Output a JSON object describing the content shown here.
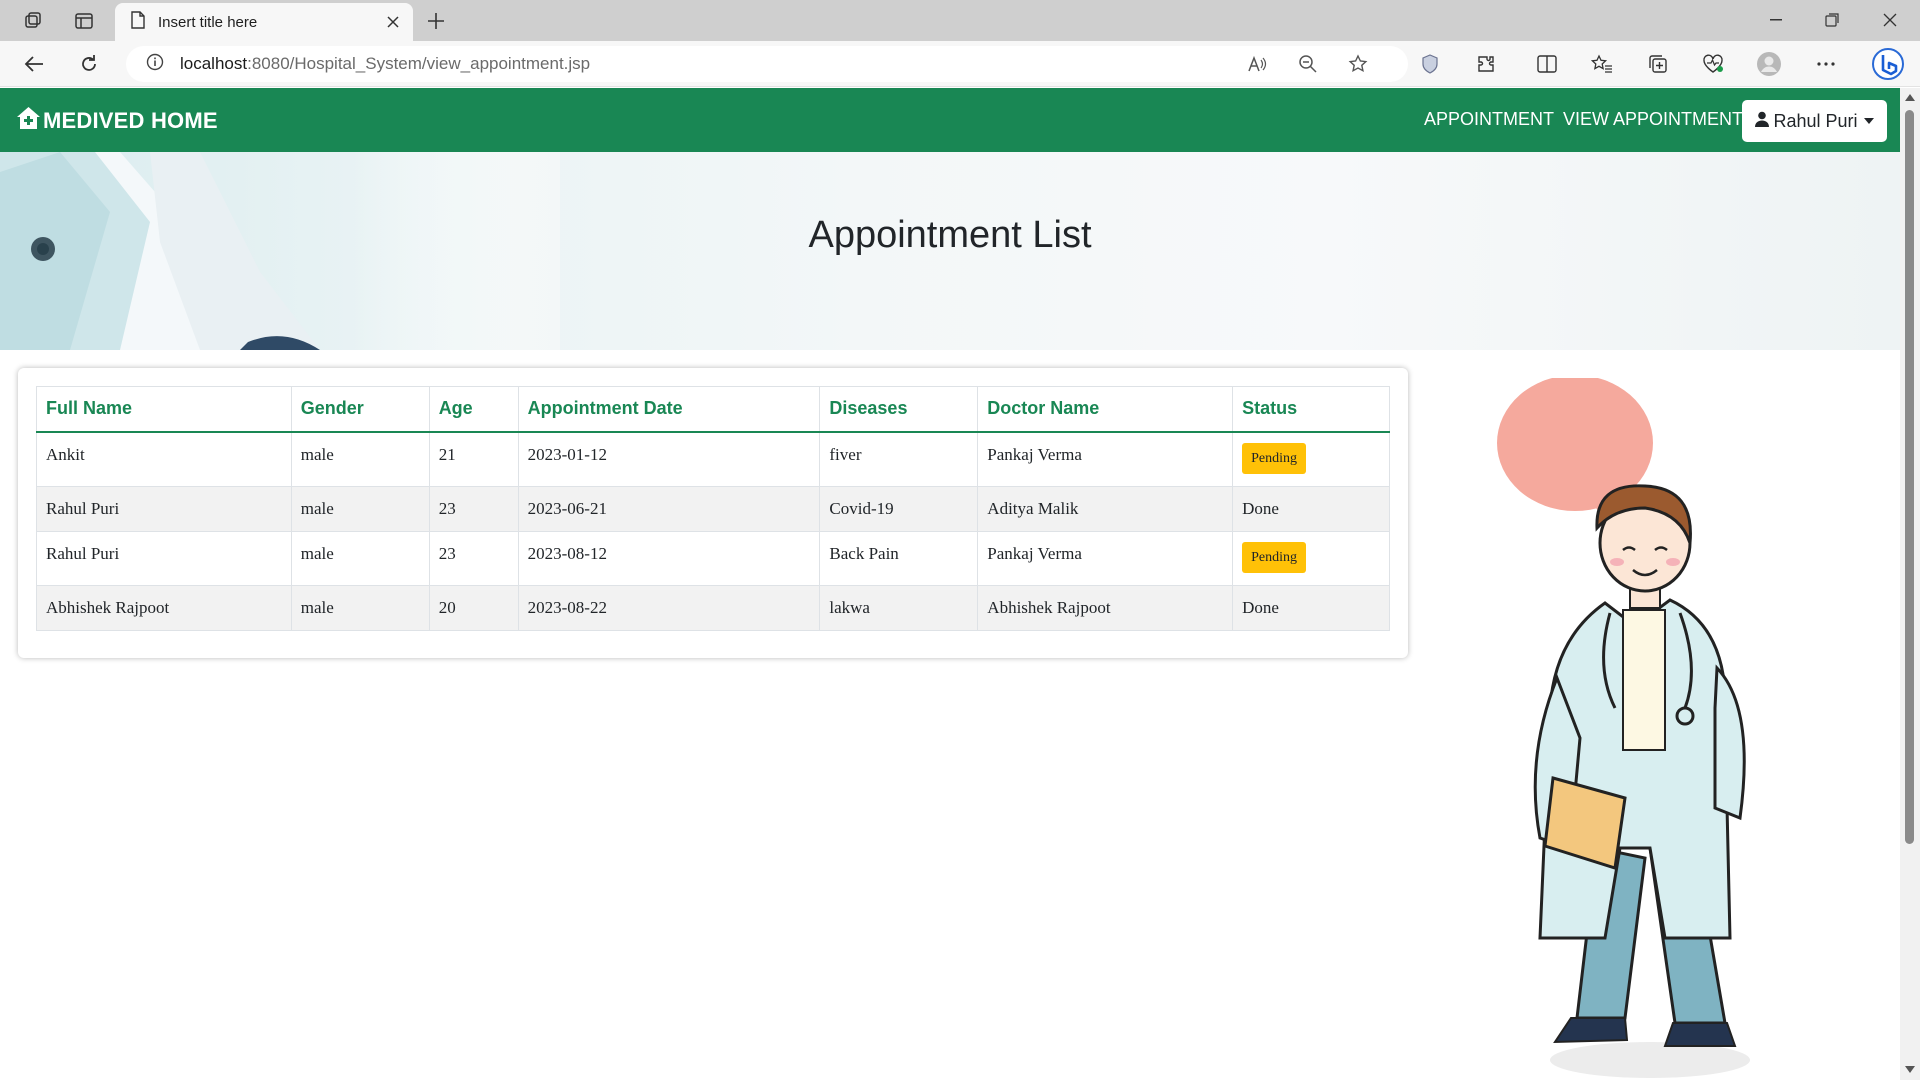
{
  "browser": {
    "tab_title": "Insert title here",
    "url_host": "localhost",
    "url_rest": ":8080/Hospital_System/view_appointment.jsp"
  },
  "navbar": {
    "brand": "MEDIVED HOME",
    "links": [
      "APPOINTMENT",
      "VIEW APPOINTMENT"
    ],
    "user": "Rahul Puri",
    "color": "#198754"
  },
  "hero": {
    "title": "Appointment List"
  },
  "table": {
    "headers": [
      "Full Name",
      "Gender",
      "Age",
      "Appointment Date",
      "Diseases",
      "Doctor Name",
      "Status"
    ],
    "rows": [
      [
        "Ankit",
        "male",
        "21",
        "2023-01-12",
        "fiver",
        "Pankaj Verma",
        "Pending"
      ],
      [
        "Rahul Puri",
        "male",
        "23",
        "2023-06-21",
        "Covid-19",
        "Aditya Malik",
        "Done"
      ],
      [
        "Rahul Puri",
        "male",
        "23",
        "2023-08-12",
        "Back Pain",
        "Pankaj Verma",
        "Pending"
      ],
      [
        "Abhishek Rajpoot",
        "male",
        "20",
        "2023-08-22",
        "lakwa",
        "Abhishek Rajpoot",
        "Done"
      ]
    ]
  },
  "colors": {
    "accent": "#198754",
    "pending_badge": "#ffc107"
  }
}
